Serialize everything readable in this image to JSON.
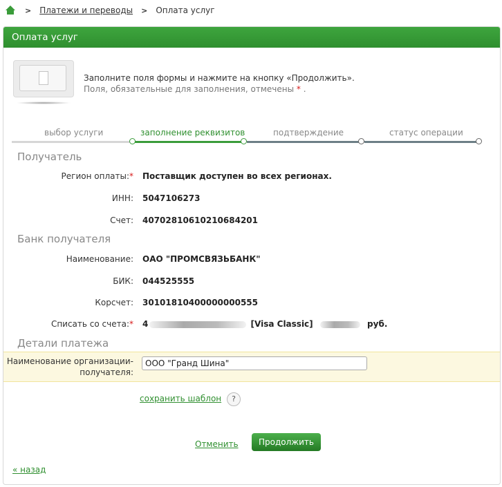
{
  "breadcrumb": {
    "home_icon": "home-icon",
    "link": "Платежи и переводы",
    "current": "Оплата услуг"
  },
  "panel": {
    "title": "Оплата услуг"
  },
  "intro": {
    "line1": "Заполните поля формы и нажмите на кнопку «Продолжить».",
    "line2_prefix": "Поля, обязательные для заполнения, отмечены",
    "required_mark": "*",
    "line2_suffix": "."
  },
  "steps": [
    {
      "label": "выбор услуги",
      "state": "done"
    },
    {
      "label": "заполнение реквизитов",
      "state": "active"
    },
    {
      "label": "подтверждение",
      "state": "pending"
    },
    {
      "label": "статус операции",
      "state": "pending"
    }
  ],
  "recipient": {
    "section_title": "Получатель",
    "region_label": "Регион оплаты:",
    "region_value": "Поставщик доступен во всех регионах.",
    "inn_label": "ИНН:",
    "inn_value": "5047106273",
    "account_label": "Счет:",
    "account_value": "40702810610210684201"
  },
  "bank": {
    "section_title": "Банк получателя",
    "name_label": "Наименование:",
    "name_value": "ОАО \"ПРОМСВЯЗЬБАНК\"",
    "bik_label": "БИК:",
    "bik_value": "044525555",
    "corr_label": "Корсчет:",
    "corr_value": "30101810400000000555",
    "debit_label": "Списать со счета:",
    "debit_prefix": "4",
    "debit_card": "[Visa Classic]",
    "debit_currency": "руб."
  },
  "details": {
    "section_title": "Детали платежа",
    "org_label_line1": "Наименование организации-",
    "org_label_line2": "получателя:",
    "org_value": "ООО \"Гранд Шина\""
  },
  "actions": {
    "save_template": "сохранить шаблон",
    "help": "?",
    "cancel": "Отменить",
    "continue": "Продолжить",
    "back": "« назад"
  },
  "colors": {
    "accent_green": "#2f8f2f",
    "required_red": "#d71a1a",
    "highlight_yellow": "#fcf8e0"
  }
}
